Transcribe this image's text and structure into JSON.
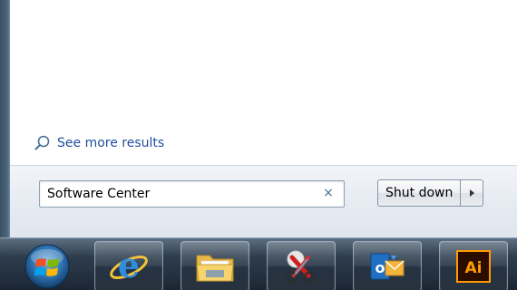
{
  "start_menu": {
    "see_more_results": "See more results",
    "search": {
      "value": "Software Center",
      "clear_symbol": "×"
    },
    "shutdown": {
      "label": "Shut down"
    }
  },
  "taskbar": {
    "buttons": [
      {
        "name": "internet-explorer",
        "icon": "ie-icon"
      },
      {
        "name": "windows-explorer",
        "icon": "folder-icon"
      },
      {
        "name": "snipping-tool",
        "icon": "scissors-icon"
      },
      {
        "name": "outlook",
        "icon": "outlook-icon"
      },
      {
        "name": "illustrator",
        "icon": "illustrator-icon",
        "icon_text": "Ai"
      }
    ]
  },
  "colors": {
    "link": "#1e4f9c",
    "taskbar": "#1b2633",
    "illustrator_orange": "#ff9a00",
    "illustrator_bg": "#2a0d00"
  }
}
